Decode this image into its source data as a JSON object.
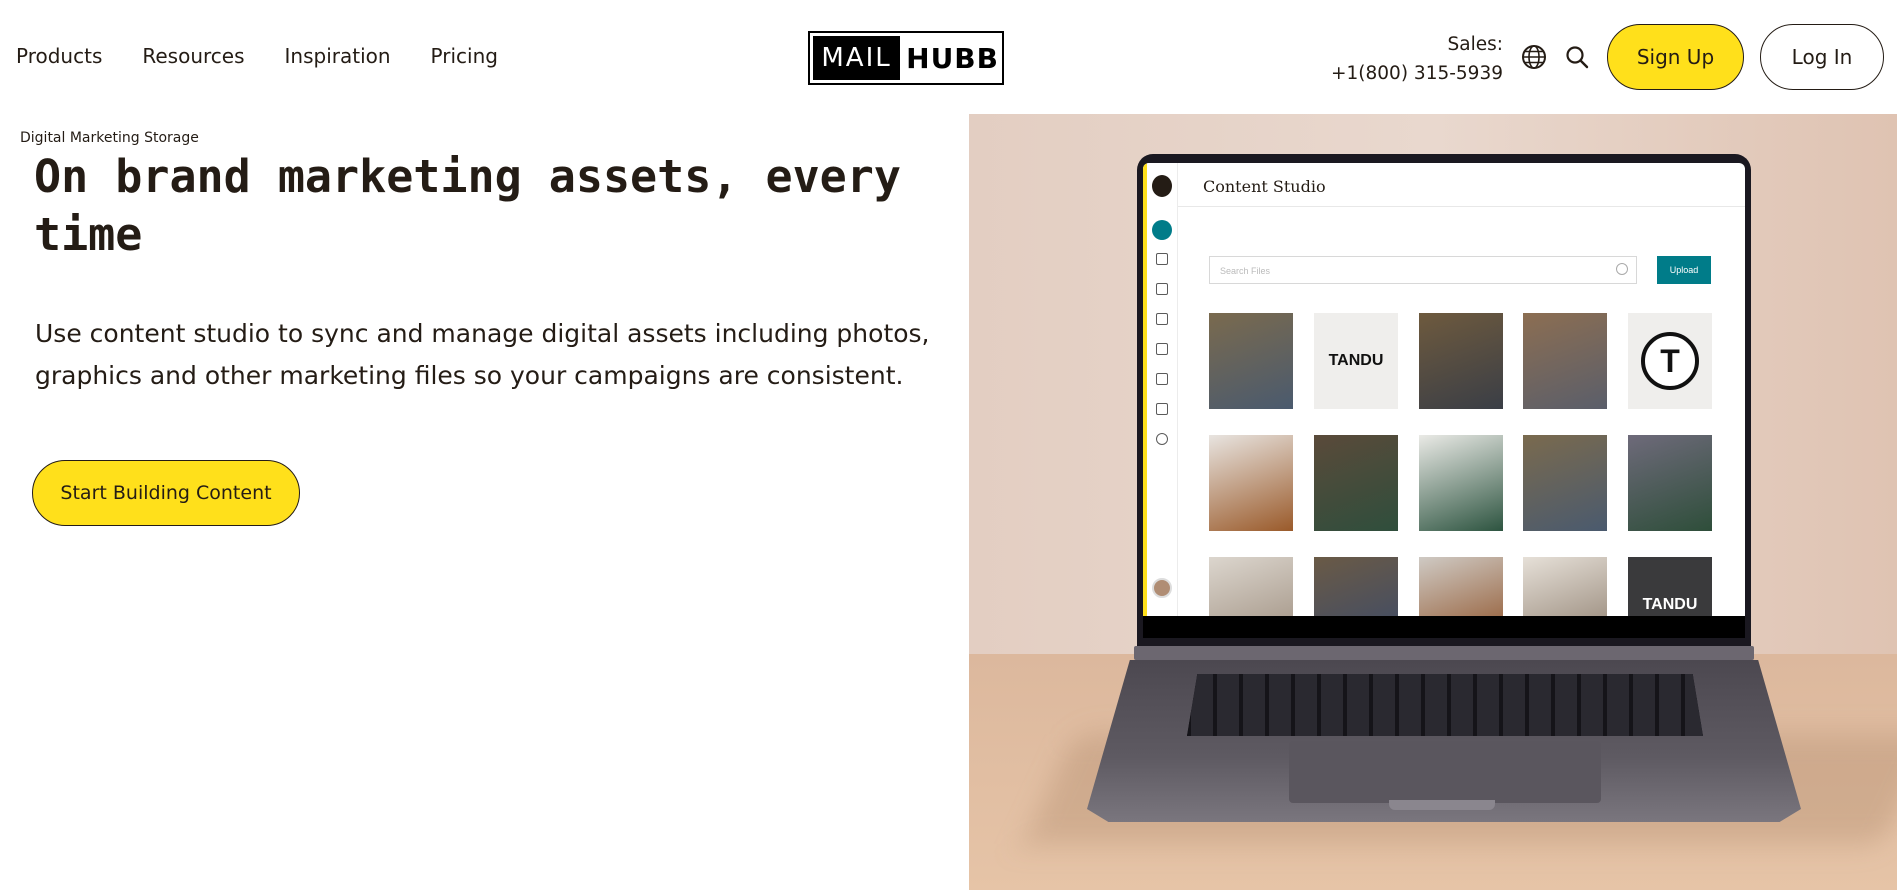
{
  "nav": {
    "links": [
      "Products",
      "Resources",
      "Inspiration",
      "Pricing"
    ],
    "logo": {
      "mail": "MAIL",
      "hubb": "HUBB"
    },
    "sales_label": "Sales:",
    "sales_phone": "+1(800) 315-5939",
    "globe_icon": "globe-icon",
    "search_icon": "search-icon",
    "signup_label": "Sign Up",
    "login_label": "Log In"
  },
  "hero": {
    "eyebrow": "Digital Marketing Storage",
    "headline": "On brand marketing assets, every time",
    "subtext": "Use content studio to sync and manage digital assets including photos, graphics and other marketing files so your campaigns are consistent.",
    "cta_label": "Start Building Content"
  },
  "screen": {
    "title": "Content Studio",
    "search_placeholder": "Search Files",
    "upload_label": "Upload",
    "tiles": [
      {
        "kind": "photo",
        "color1": "#7a6a4e",
        "color2": "#4a5a6e"
      },
      {
        "kind": "text",
        "text": "TANDU",
        "bg": "#efeeec",
        "fg": "#111111"
      },
      {
        "kind": "photo",
        "color1": "#6e5a3e",
        "color2": "#3a3e46"
      },
      {
        "kind": "photo",
        "color1": "#8c6e52",
        "color2": "#5a5e6a"
      },
      {
        "kind": "ring",
        "text": "T",
        "bg": "#efeeec",
        "fg": "#111111"
      },
      {
        "kind": "photo",
        "color1": "#e8e4e0",
        "color2": "#9a5a2a"
      },
      {
        "kind": "photo",
        "color1": "#5a4a3a",
        "color2": "#2f4e3c"
      },
      {
        "kind": "photo",
        "color1": "#eaeae6",
        "color2": "#2d5440"
      },
      {
        "kind": "photo",
        "color1": "#7a6a4e",
        "color2": "#4a5a6e"
      },
      {
        "kind": "photo",
        "color1": "#6e6a7a",
        "color2": "#2e4e3a"
      },
      {
        "kind": "photo",
        "color1": "#dcd6ce",
        "color2": "#9a8a7a"
      },
      {
        "kind": "photo",
        "color1": "#6a5a46",
        "color2": "#3a4a6a"
      },
      {
        "kind": "photo",
        "color1": "#cfcac4",
        "color2": "#8a4a1e"
      },
      {
        "kind": "photo",
        "color1": "#e6e0d8",
        "color2": "#8a7a6a"
      },
      {
        "kind": "text",
        "text": "TANDU",
        "bg": "#3a3a3c",
        "fg": "#ffffff"
      }
    ]
  },
  "colors": {
    "accent": "#ffe01b",
    "teal": "#007c89",
    "ink": "#241c15"
  }
}
